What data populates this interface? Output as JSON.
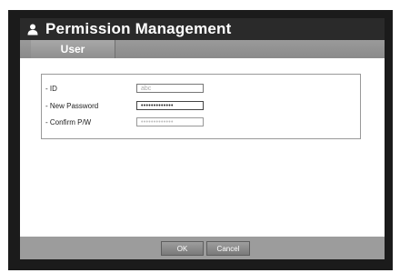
{
  "dialog": {
    "title": "Permission Management",
    "title_icon": "user-icon"
  },
  "tabs": [
    {
      "label": "User",
      "selected": true
    }
  ],
  "fields": [
    {
      "label": "- ID",
      "value": "abc",
      "state": "disabled"
    },
    {
      "label": "- New Password",
      "value": "•••••••••••••",
      "state": "active"
    },
    {
      "label": "- Confirm P/W",
      "value": "•••••••••••••",
      "state": "dim"
    }
  ],
  "buttons": {
    "ok_label": "OK",
    "cancel_label": "Cancel"
  }
}
